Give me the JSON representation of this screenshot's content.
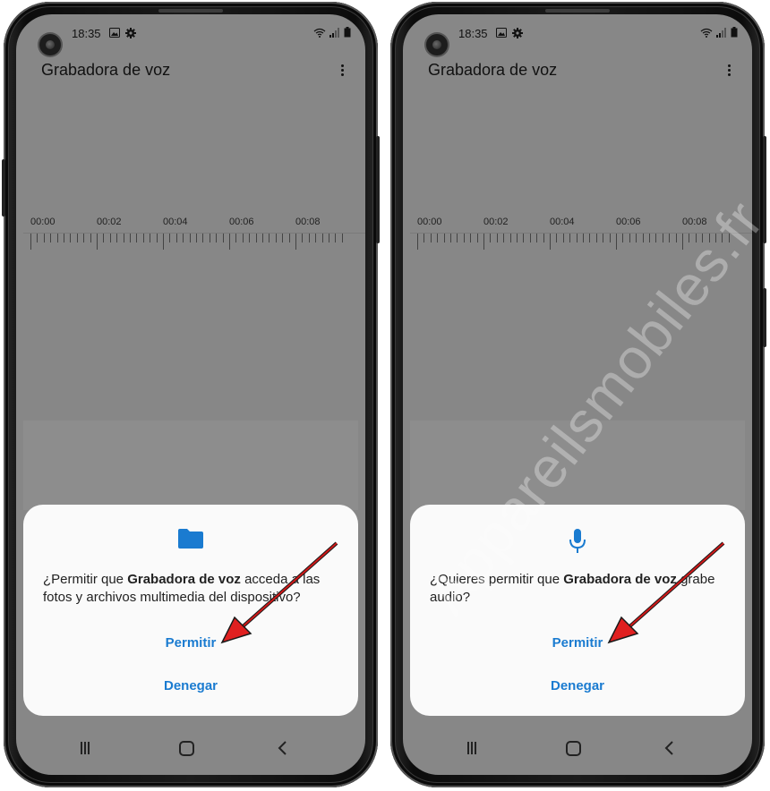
{
  "screens": [
    {
      "status_time": "18:35",
      "app_title": "Grabadora de voz",
      "timeline_labels": [
        "00:00",
        "00:02",
        "00:04",
        "00:06",
        "00:08"
      ],
      "dialog": {
        "icon": "folder-icon",
        "text_before": "¿Permitir que ",
        "app_name": "Grabadora de voz",
        "text_after": " acceda a las fotos y archivos multimedia del dispositivo?",
        "allow_label": "Permitir",
        "deny_label": "Denegar"
      }
    },
    {
      "status_time": "18:35",
      "app_title": "Grabadora de voz",
      "timeline_labels": [
        "00:00",
        "00:02",
        "00:04",
        "00:06",
        "00:08"
      ],
      "dialog": {
        "icon": "microphone-icon",
        "text_before": "¿Quieres permitir que ",
        "app_name": "Grabadora de voz",
        "text_after": " grabe audio?",
        "allow_label": "Permitir",
        "deny_label": "Denegar"
      }
    }
  ],
  "watermark": "Appareilsmobiles.fr",
  "colors": {
    "accent": "#1a7bd0",
    "screen_dim": "#878787",
    "dialog_bg": "#fafafa",
    "arrow": "#e02020"
  }
}
